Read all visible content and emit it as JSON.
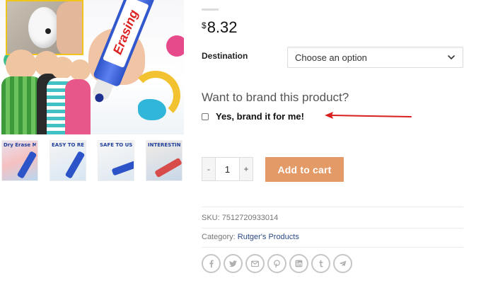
{
  "product": {
    "price_currency": "$",
    "price_value": "8.32",
    "thumbnails": [
      {
        "caption": "Dry Erase Marker Pen"
      },
      {
        "caption": "EASY TO REMOVE"
      },
      {
        "caption": "SAFE TO USE"
      },
      {
        "caption": "INTERESTING AND FUN"
      }
    ],
    "main_image_text": "Erasing"
  },
  "options": {
    "destination_label": "Destination",
    "destination_value": "Choose an option"
  },
  "branding": {
    "question": "Want to brand this product?",
    "checkbox_label": "Yes, brand it for me!",
    "checked": false,
    "arrow_color": "#d8201e"
  },
  "cart": {
    "minus_label": "-",
    "quantity": "1",
    "plus_label": "+",
    "add_to_cart_label": "Add to cart",
    "button_color": "#e39a66"
  },
  "meta": {
    "sku_label": "SKU:",
    "sku_value": "7512720933014",
    "category_label": "Category:",
    "category_value": "Rutger's Products"
  },
  "share_icons": [
    "facebook-icon",
    "twitter-icon",
    "email-icon",
    "pinterest-icon",
    "linkedin-icon",
    "tumblr-icon",
    "telegram-icon"
  ]
}
